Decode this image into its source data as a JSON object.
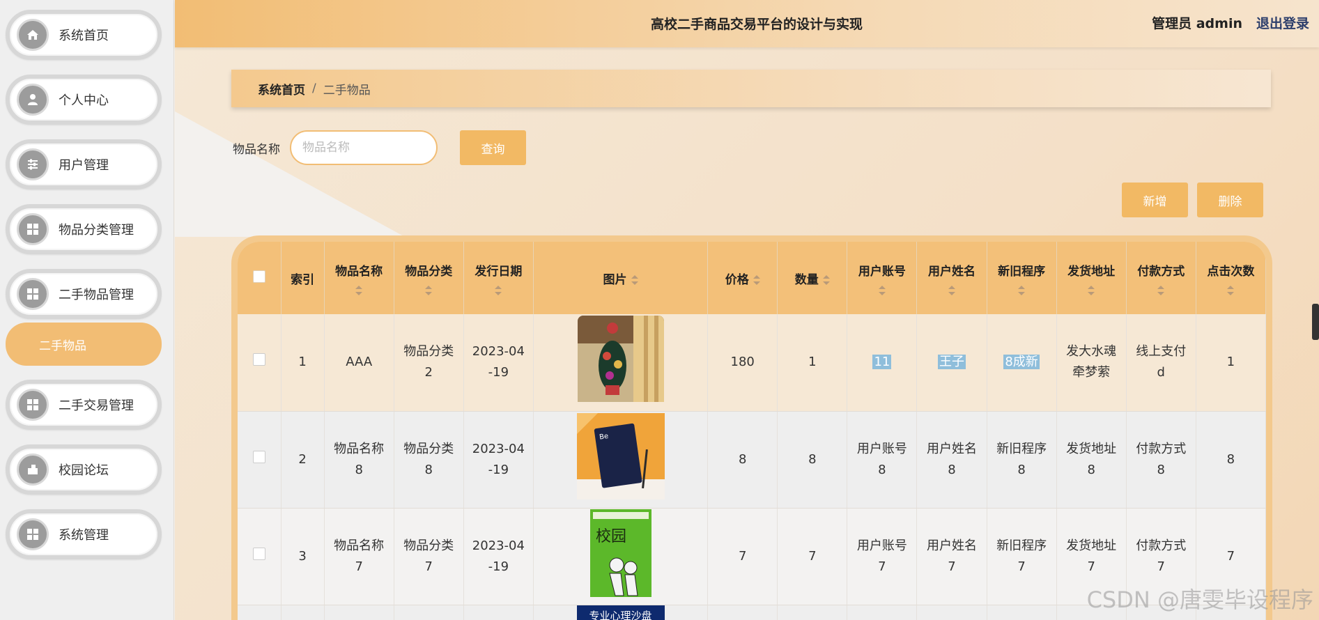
{
  "app": {
    "title": "高校二手商品交易平台的设计与实现",
    "admin": "管理员 admin",
    "logout": "退出登录"
  },
  "sidebar": {
    "items": [
      {
        "label": "系统首页",
        "icon": "home-icon"
      },
      {
        "label": "个人中心",
        "icon": "user-icon"
      },
      {
        "label": "用户管理",
        "icon": "sliders-icon"
      },
      {
        "label": "物品分类管理",
        "icon": "grid-icon"
      },
      {
        "label": "二手物品管理",
        "icon": "grid-icon"
      },
      {
        "label": "二手交易管理",
        "icon": "grid-icon"
      },
      {
        "label": "校园论坛",
        "icon": "forum-icon"
      },
      {
        "label": "系统管理",
        "icon": "grid-icon"
      }
    ],
    "submenu": "二手物品"
  },
  "breadcrumb": {
    "home": "系统首页",
    "sep": "/",
    "current": "二手物品"
  },
  "search": {
    "label": "物品名称",
    "placeholder": "物品名称",
    "query_btn": "查询"
  },
  "actions": {
    "add": "新增",
    "delete": "删除"
  },
  "table": {
    "headers": [
      "索引",
      "物品名称",
      "物品分类",
      "发行日期",
      "图片",
      "价格",
      "数量",
      "用户账号",
      "用户姓名",
      "新旧程序",
      "发货地址",
      "付款方式",
      "点击次数"
    ],
    "rows": [
      {
        "index": "1",
        "name": "AAA",
        "category": [
          "物品分类",
          "2"
        ],
        "date": [
          "2023-04",
          "-19"
        ],
        "price": "180",
        "qty": "1",
        "account": "11",
        "username": "王子",
        "condition": "8成新",
        "address": [
          "发大水魂",
          "牵梦萦"
        ],
        "payment": [
          "线上支付",
          "d"
        ],
        "clicks": "1"
      },
      {
        "index": "2",
        "name": [
          "物品名称",
          "8"
        ],
        "category": [
          "物品分类",
          "8"
        ],
        "date": [
          "2023-04",
          "-19"
        ],
        "price": "8",
        "qty": "8",
        "account": [
          "用户账号",
          "8"
        ],
        "username": [
          "用户姓名",
          "8"
        ],
        "condition": [
          "新旧程序",
          "8"
        ],
        "address": [
          "发货地址",
          "8"
        ],
        "payment": [
          "付款方式",
          "8"
        ],
        "clicks": "8"
      },
      {
        "index": "3",
        "name": [
          "物品名称",
          "7"
        ],
        "category": [
          "物品分类",
          "7"
        ],
        "date": [
          "2023-04",
          "-19"
        ],
        "price": "7",
        "qty": "7",
        "account": [
          "用户账号",
          "7"
        ],
        "username": [
          "用户姓名",
          "7"
        ],
        "condition": [
          "新旧程序",
          "7"
        ],
        "address": [
          "发货地址",
          "7"
        ],
        "payment": [
          "付款方式",
          "7"
        ],
        "clicks": "7"
      }
    ],
    "row4_image_text": "专业心理沙盘",
    "row3_image_text": "校园"
  },
  "watermark": "CSDN @唐雯毕设程序",
  "colors": {
    "accent": "#f2bd74",
    "button": "#f2b964",
    "highlight": "#8fbedb"
  }
}
